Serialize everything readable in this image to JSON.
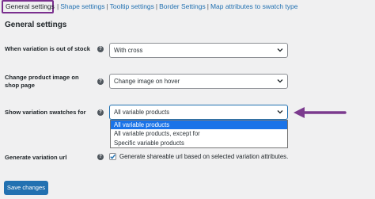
{
  "tabs": {
    "active": "General settings",
    "items": [
      "Shape settings",
      "Tooltip settings",
      "Border Settings",
      "Map attributes to swatch type"
    ],
    "separator": "|"
  },
  "section_title": "General settings",
  "fields": {
    "out_of_stock": {
      "label": "When variation is out of stock",
      "value": "With cross"
    },
    "product_image": {
      "label_line1": "Change product image on",
      "label_line2": "shop page",
      "value": "Change image on hover"
    },
    "show_swatches": {
      "label": "Show variation swatches for",
      "value": "All variable products",
      "options": [
        "All variable products",
        "All variable products, except for",
        "Specific variable products"
      ],
      "selected_index": 0
    },
    "variation_url": {
      "label": "Generate variation url",
      "checkbox_label": "Generate shareable url based on selected variation attributes.",
      "checked": true
    }
  },
  "help_glyph": "?",
  "save_button": "Save changes",
  "colors": {
    "tab_highlight": "#7a2f8e",
    "arrow": "#7b3a8e",
    "link": "#2271b1",
    "primary_button": "#2271b1",
    "option_selected": "#1a73e8"
  },
  "icons": {
    "help": "question-circle-icon",
    "select": "chevron-down-icon",
    "check": "checkmark-icon",
    "annotation": "arrow-left-icon"
  }
}
